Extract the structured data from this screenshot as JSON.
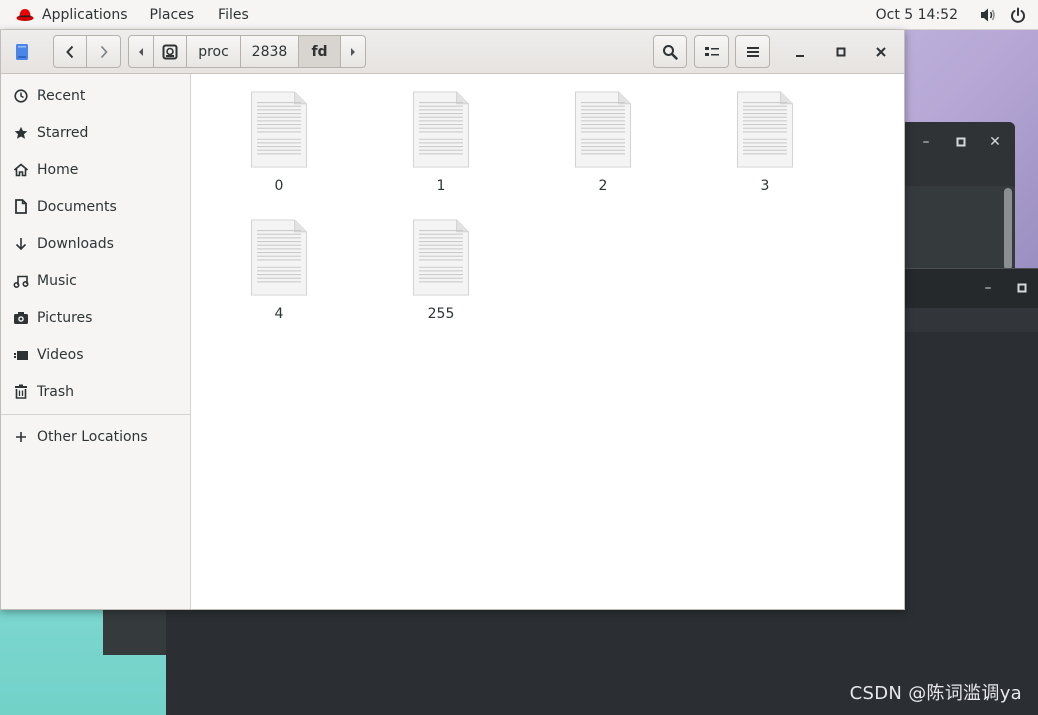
{
  "topbar": {
    "menus": [
      "Applications",
      "Places",
      "Files"
    ],
    "clock": "Oct 5  14:52",
    "tray_icons": [
      "volume-icon",
      "power-icon"
    ]
  },
  "window": {
    "app_icon": "files-app-icon",
    "path": [
      "proc",
      "2838",
      "fd"
    ],
    "active_crumb": "fd"
  },
  "sidebar": {
    "items": [
      {
        "label": "Recent",
        "icon": "clock-icon"
      },
      {
        "label": "Starred",
        "icon": "star-icon"
      },
      {
        "label": "Home",
        "icon": "home-icon"
      },
      {
        "label": "Documents",
        "icon": "document-icon"
      },
      {
        "label": "Downloads",
        "icon": "download-icon"
      },
      {
        "label": "Music",
        "icon": "music-icon"
      },
      {
        "label": "Pictures",
        "icon": "camera-icon"
      },
      {
        "label": "Videos",
        "icon": "video-icon"
      },
      {
        "label": "Trash",
        "icon": "trash-icon"
      },
      {
        "label": "Other Locations",
        "icon": "plus-icon"
      }
    ]
  },
  "files": [
    {
      "name": "0"
    },
    {
      "name": "1"
    },
    {
      "name": "2"
    },
    {
      "name": "3"
    },
    {
      "name": "4"
    },
    {
      "name": "255"
    }
  ],
  "watermark": "CSDN @陈词滥调ya"
}
